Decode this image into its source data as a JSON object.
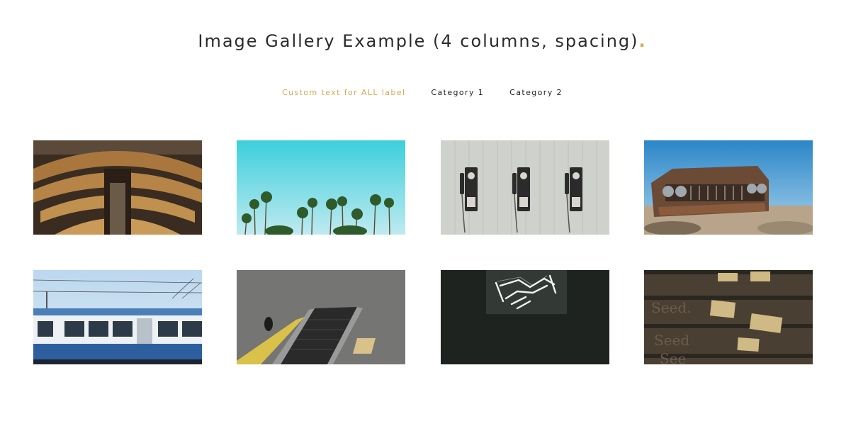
{
  "title": "Image Gallery Example (4 columns, spacing)",
  "title_dot": ".",
  "accent_color": "#d6a84f",
  "filters": [
    {
      "label": "Custom text for ALL label",
      "active": true
    },
    {
      "label": "Category 1",
      "active": false
    },
    {
      "label": "Category 2",
      "active": false
    }
  ],
  "gallery": {
    "columns": 4,
    "items": [
      {
        "name": "library-arches"
      },
      {
        "name": "palm-trees"
      },
      {
        "name": "payphones"
      },
      {
        "name": "rusty-car"
      },
      {
        "name": "tram"
      },
      {
        "name": "conveyor-belt"
      },
      {
        "name": "neon-handshake"
      },
      {
        "name": "seed-drawers"
      }
    ]
  }
}
